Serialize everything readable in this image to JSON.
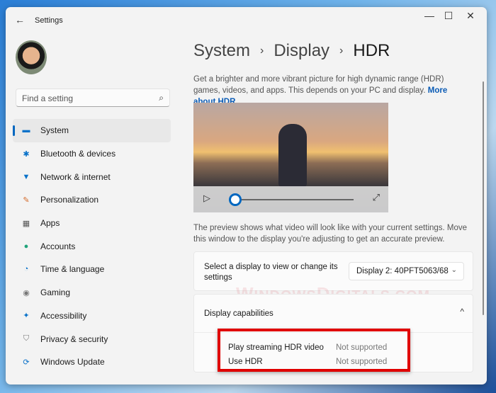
{
  "window": {
    "title": "Settings",
    "back": "←",
    "minimize": "—",
    "maximize": "☐",
    "close": "✕"
  },
  "search": {
    "placeholder": "Find a setting",
    "icon": "⌕"
  },
  "sidebar": {
    "items": [
      {
        "label": "System",
        "icon": "▬",
        "color": "#0a72c9"
      },
      {
        "label": "Bluetooth & devices",
        "icon": "✱",
        "color": "#0a72c9"
      },
      {
        "label": "Network & internet",
        "icon": "▼",
        "color": "#0a72c9"
      },
      {
        "label": "Personalization",
        "icon": "✎",
        "color": "#d46a2a"
      },
      {
        "label": "Apps",
        "icon": "▦",
        "color": "#555"
      },
      {
        "label": "Accounts",
        "icon": "●",
        "color": "#1fa37a"
      },
      {
        "label": "Time & language",
        "icon": "◔",
        "color": "#0a72c9"
      },
      {
        "label": "Gaming",
        "icon": "◉",
        "color": "#777"
      },
      {
        "label": "Accessibility",
        "icon": "✦",
        "color": "#0a72c9"
      },
      {
        "label": "Privacy & security",
        "icon": "⛉",
        "color": "#777"
      },
      {
        "label": "Windows Update",
        "icon": "⟳",
        "color": "#0a72c9"
      }
    ]
  },
  "breadcrumb": {
    "items": [
      "System",
      "Display",
      "HDR"
    ],
    "sep": "›"
  },
  "description": {
    "text": "Get a brighter and more vibrant picture for high dynamic range (HDR) games, videos, and apps. This depends on your PC and display.",
    "link": "More about HDR"
  },
  "video": {
    "play": "▷",
    "fullscreen": "⤢",
    "progress": 0.0
  },
  "preview_note": "The preview shows what video will look like with your current settings. Move this window to the display you're adjusting to get an accurate preview.",
  "display_select": {
    "label": "Select a display to view or change its settings",
    "value": "Display 2: 40PFT5063/68",
    "chevron": "⌄"
  },
  "capabilities": {
    "header": "Display capabilities",
    "chevron": "^",
    "rows": [
      {
        "name": "Play streaming HDR video",
        "value": "Not supported"
      },
      {
        "name": "Use HDR",
        "value": "Not supported"
      }
    ]
  },
  "watermark": "WindowsDigitals.com"
}
